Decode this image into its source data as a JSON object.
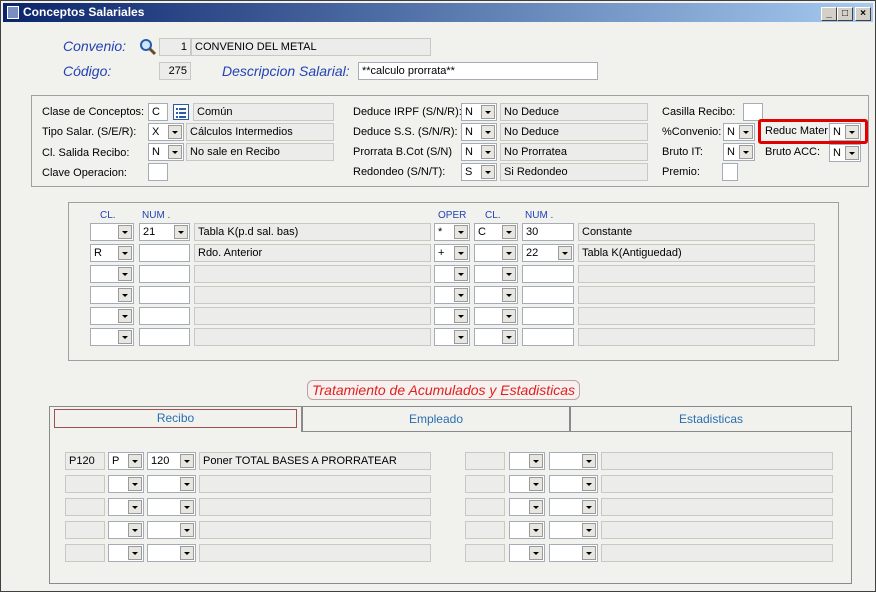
{
  "window": {
    "title": "Conceptos Salariales",
    "min": "_",
    "max": "□",
    "close": "×"
  },
  "header": {
    "convenio_label": "Convenio:",
    "convenio_code": "1",
    "convenio_name": "CONVENIO DEL METAL",
    "codigo_label": "Código:",
    "codigo_value": "275",
    "descripcion_label": "Descripcion Salarial:",
    "descripcion_value": "**calculo prorrata**"
  },
  "left": {
    "clase_label": "Clase de Conceptos:",
    "clase_value": "C",
    "clase_desc": "Común",
    "tipo_label": "Tipo Salar. (S/E/R):",
    "tipo_value": "X",
    "tipo_desc": "Cálculos Intermedios",
    "salida_label": "Cl. Salida Recibo:",
    "salida_value": "N",
    "salida_desc": "No sale en Recibo",
    "clave_label": "Clave Operacion:",
    "clave_value": ""
  },
  "middle": {
    "irpf_label": "Deduce IRPF (S/N/R):",
    "irpf_value": "N",
    "irpf_desc": "No Deduce",
    "ss_label": "Deduce S.S. (S/N/R):",
    "ss_value": "N",
    "ss_desc": "No Deduce",
    "prorrata_label": "Prorrata B.Cot (S/N)",
    "prorrata_value": "N",
    "prorrata_desc": "No Prorratea",
    "redondeo_label": "Redondeo (S/N/T):",
    "redondeo_value": "S",
    "redondeo_desc": "Si Redondeo"
  },
  "right": {
    "casilla_label": "Casilla Recibo:",
    "casilla_value": "",
    "convenio_label": "%Convenio:",
    "convenio_value": "N",
    "reduc_label": "Reduc Mater",
    "reduc_value": "N",
    "bruto_it_label": "Bruto IT:",
    "bruto_it_value": "N",
    "bruto_acc_label": "Bruto ACC:",
    "bruto_acc_value": "N",
    "premio_label": "Premio:",
    "premio_value": ""
  },
  "formula": {
    "headers": {
      "cl": "CL.",
      "num": "NUM .",
      "oper": "OPER",
      "cl2": "CL.",
      "num2": "NUM ."
    },
    "rows": [
      {
        "cl": "",
        "num": "21",
        "desc": "Tabla K(p.d sal. bas)",
        "oper": "*",
        "cl2": "C",
        "num2": "30",
        "desc2": "Constante"
      },
      {
        "cl": "R",
        "num": "",
        "desc": "Rdo. Anterior",
        "oper": "+",
        "cl2": "",
        "num2": "22",
        "desc2": "Tabla K(Antiguedad)"
      },
      {
        "cl": "",
        "num": "",
        "desc": "",
        "oper": "",
        "cl2": "",
        "num2": "",
        "desc2": ""
      },
      {
        "cl": "",
        "num": "",
        "desc": "",
        "oper": "",
        "cl2": "",
        "num2": "",
        "desc2": ""
      },
      {
        "cl": "",
        "num": "",
        "desc": "",
        "oper": "",
        "cl2": "",
        "num2": "",
        "desc2": ""
      },
      {
        "cl": "",
        "num": "",
        "desc": "",
        "oper": "",
        "cl2": "",
        "num2": "",
        "desc2": ""
      }
    ]
  },
  "section_title": "Tratamiento de Acumulados y Estadisticas",
  "tabs": [
    "Recibo",
    "Empleado",
    "Estadisticas"
  ],
  "recibo": {
    "rows": [
      {
        "code": "P120",
        "cl": "P",
        "num": "120",
        "desc": "Poner  TOTAL BASES A PRORRATEAR"
      },
      {
        "code": "",
        "cl": "",
        "num": "",
        "desc": ""
      },
      {
        "code": "",
        "cl": "",
        "num": "",
        "desc": ""
      },
      {
        "code": "",
        "cl": "",
        "num": "",
        "desc": ""
      },
      {
        "code": "",
        "cl": "",
        "num": "",
        "desc": ""
      }
    ]
  }
}
